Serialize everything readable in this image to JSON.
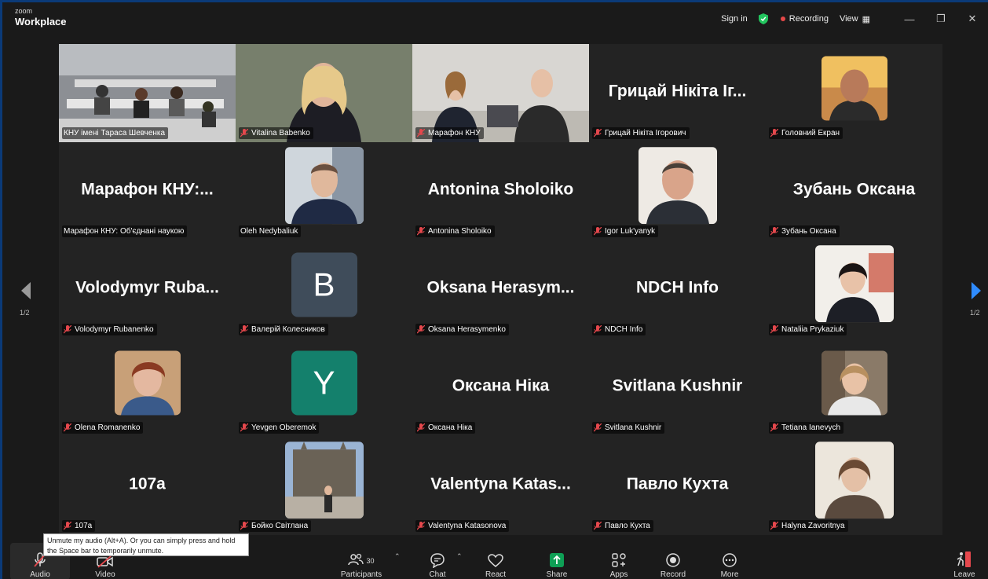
{
  "app": {
    "brand_top": "zoom",
    "brand_bottom": "Workplace"
  },
  "titlebar": {
    "sign_in": "Sign in",
    "recording": "Recording",
    "view": "View",
    "icons": [
      "shield-check-icon",
      "record-dot-icon",
      "grid-view-icon",
      "minimize-icon",
      "restore-icon",
      "close-icon"
    ]
  },
  "pagination": {
    "left": "1/2",
    "right": "1/2"
  },
  "tiles": [
    {
      "name": "КНУ імені Тараса Шевченка",
      "mode": "video",
      "active": true,
      "muted": false
    },
    {
      "name": "Vitalina Babenko",
      "mode": "video",
      "muted": true
    },
    {
      "name": "Марафон КНУ",
      "mode": "video",
      "muted": true
    },
    {
      "name": "Грицай Нікіта Ігорович",
      "display": "Грицай  Нікіта  Іг...",
      "mode": "text",
      "muted": true
    },
    {
      "name": "Головний Екран",
      "mode": "photo",
      "muted": true
    },
    {
      "name": "Марафон КНУ: Об'єднані наукою",
      "display": "Марафон  КНУ:...",
      "mode": "text",
      "muted": false
    },
    {
      "name": "Oleh Nedybaliuk",
      "mode": "photo",
      "muted": false
    },
    {
      "name": "Antonina Sholoiko",
      "display": "Antonina  Sholoiko",
      "mode": "text",
      "muted": true
    },
    {
      "name": "Igor Luk'yanyk",
      "mode": "photo",
      "muted": true
    },
    {
      "name": "Зубань Оксана",
      "display": "Зубань  Оксана",
      "mode": "text",
      "muted": true
    },
    {
      "name": "Volodymyr Rubanenko",
      "display": "Volodymyr  Ruba...",
      "mode": "text",
      "muted": true
    },
    {
      "name": "Валерій Колесников",
      "letter": "B",
      "mode": "letter",
      "color": "#3f4c5a",
      "muted": true
    },
    {
      "name": "Oksana Herasymenko",
      "display": "Oksana  Herasym...",
      "mode": "text",
      "muted": true
    },
    {
      "name": "NDCH Info",
      "display": "NDCH  Info",
      "mode": "text",
      "muted": true
    },
    {
      "name": "Nataliia Prykaziuk",
      "mode": "photo",
      "muted": true
    },
    {
      "name": "Olena Romanenko",
      "mode": "photo",
      "muted": true
    },
    {
      "name": "Yevgen Oberemok",
      "letter": "Y",
      "mode": "letter",
      "color": "#14806c",
      "muted": true
    },
    {
      "name": "Оксана Ніка",
      "display": "Оксана  Ніка",
      "mode": "text",
      "muted": true
    },
    {
      "name": "Svitlana Kushnir",
      "display": "Svitlana  Kushnir",
      "mode": "text",
      "muted": true
    },
    {
      "name": "Tetiana Ianevych",
      "mode": "photo",
      "muted": true
    },
    {
      "name": "107a",
      "display": "107a",
      "mode": "text",
      "muted": true
    },
    {
      "name": "Бойко Світлана",
      "mode": "photo",
      "muted": true
    },
    {
      "name": "Valentyna Katasonova",
      "display": "Valentyna  Katas...",
      "mode": "text",
      "muted": true
    },
    {
      "name": "Павло Кухта",
      "display": "Павло  Кухта",
      "mode": "text",
      "muted": true
    },
    {
      "name": "Halyna Zavoritnya",
      "mode": "photo",
      "muted": true
    }
  ],
  "toolbar": {
    "audio": "Audio",
    "video": "Video",
    "participants": "Participants",
    "participants_count": "30",
    "chat": "Chat",
    "react": "React",
    "share": "Share",
    "apps": "Apps",
    "record": "Record",
    "more": "More",
    "leave": "Leave"
  },
  "tooltip": {
    "text": "Unmute my audio (Alt+A). Or you can simply press and hold the Space bar to temporarily unmute."
  },
  "colors": {
    "accent_green": "#22c55e",
    "share_green": "#0e9f55",
    "mute_red": "#e5484d"
  }
}
